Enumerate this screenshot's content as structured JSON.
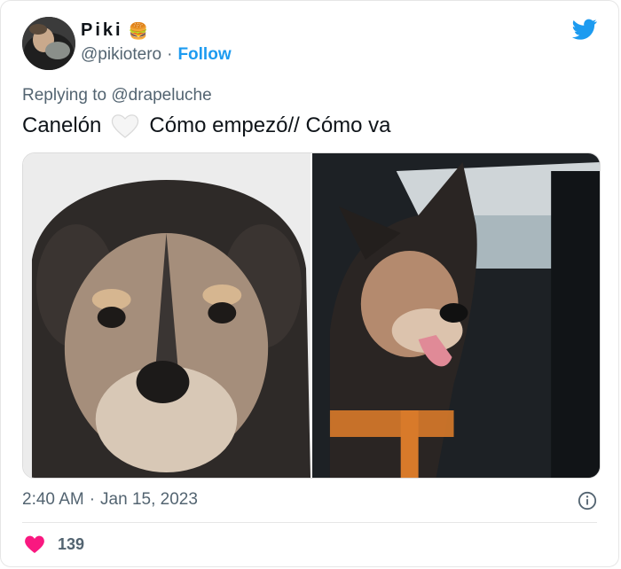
{
  "author": {
    "display_name": "Piki",
    "emoji": "🍔",
    "handle": "@pikiotero",
    "separator": "·",
    "follow_label": "Follow"
  },
  "reply": {
    "prefix": "Replying to",
    "mention": "@drapeluche"
  },
  "tweet": {
    "text_before": "Canelón",
    "text_after": "Cómo empezó// Cómo va"
  },
  "media": {
    "left_image": "puppy-face-photo",
    "right_image": "dog-in-car-photo"
  },
  "meta": {
    "time": "2:40 AM",
    "separator": "·",
    "date": "Jan 15, 2023"
  },
  "engagement": {
    "likes": "139"
  },
  "colors": {
    "accent": "#1d9bf0",
    "like": "#f91880",
    "secondary_text": "#536471"
  },
  "icons": {
    "brand": "twitter-bird-icon",
    "info": "info-icon",
    "like": "heart-icon",
    "emoji_heart": "white-heart-icon"
  }
}
